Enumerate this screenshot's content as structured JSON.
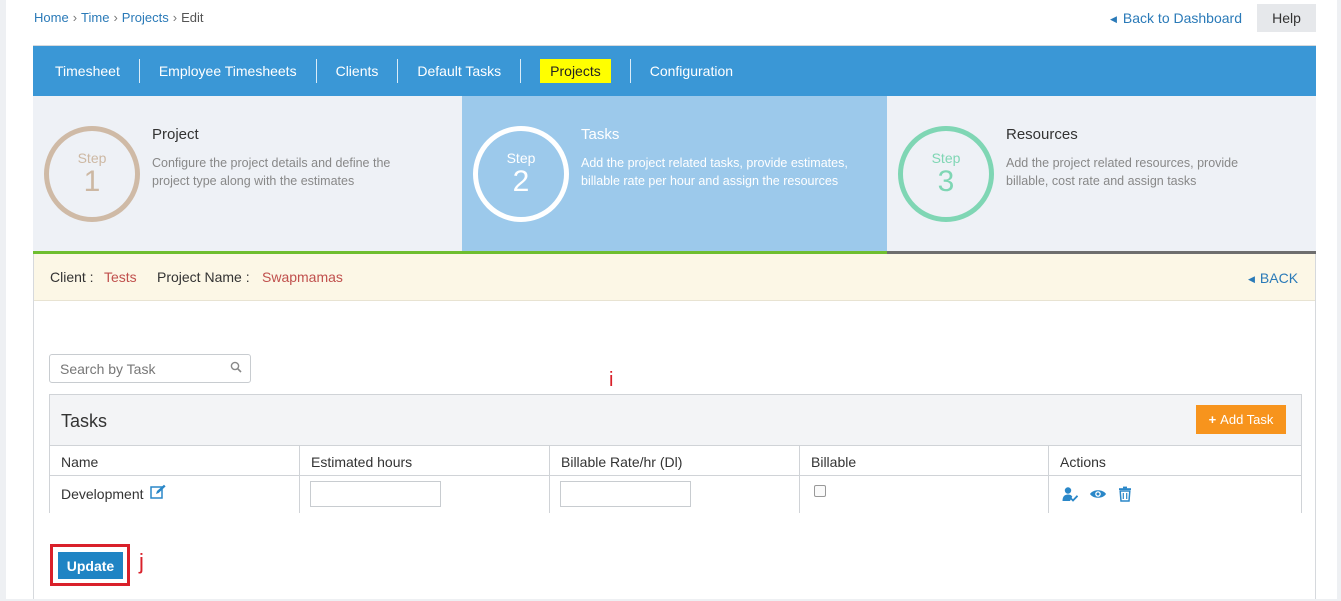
{
  "breadcrumb": {
    "home": "Home",
    "time": "Time",
    "projects": "Projects",
    "current": "Edit",
    "separator": "›"
  },
  "header": {
    "back_to_dashboard": "Back to Dashboard",
    "help": "Help"
  },
  "nav": {
    "items": [
      "Timesheet",
      "Employee Timesheets",
      "Clients",
      "Default Tasks",
      "Projects",
      "Configuration"
    ],
    "active": "Projects"
  },
  "steps": [
    {
      "step_label": "Step",
      "number": "1",
      "title": "Project",
      "description": "Configure the project details and define the project type along with the estimates"
    },
    {
      "step_label": "Step",
      "number": "2",
      "title": "Tasks",
      "description": "Add the project related tasks, provide estimates, billable rate per hour and assign the resources"
    },
    {
      "step_label": "Step",
      "number": "3",
      "title": "Resources",
      "description": "Add the project related resources, provide billable, cost rate and assign tasks"
    }
  ],
  "info": {
    "client_label": "Client :",
    "client_value": "Tests",
    "project_label": "Project Name :",
    "project_value": "Swapmamas",
    "back": "BACK"
  },
  "search": {
    "placeholder": "Search by Task"
  },
  "tasks": {
    "title": "Tasks",
    "add_task": "Add Task",
    "columns": [
      "Name",
      "Estimated hours",
      "Billable Rate/hr (Dl)",
      "Billable",
      "Actions"
    ],
    "rows": [
      {
        "name": "Development",
        "estimated_hours": "",
        "billable_rate": "",
        "billable": false
      }
    ]
  },
  "annotations": {
    "i": "i",
    "j": "j"
  },
  "update_button": "Update",
  "colors": {
    "nav_bg": "#3a97d6",
    "active_highlight": "#ffff00",
    "annotation_red": "#d9202a",
    "add_task_orange": "#f7941d",
    "update_blue": "#1f84c4"
  }
}
